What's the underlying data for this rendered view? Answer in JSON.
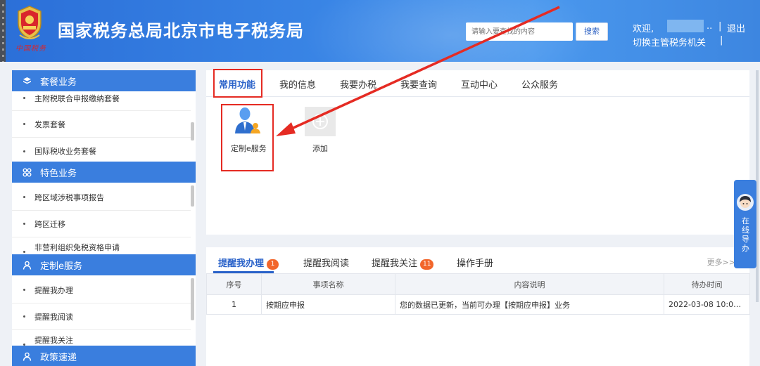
{
  "header": {
    "site_title": "国家税务总局北京市电子税务局",
    "emblem_text": "中国税务",
    "search_placeholder": "请输入要查找的内容",
    "search_button": "搜索",
    "welcome": "欢迎,",
    "dots": "..",
    "separator": "|",
    "logout": "退出",
    "switch_org": "切换主管税务机关"
  },
  "sidebar": {
    "sections": [
      {
        "label": "套餐业务",
        "icon": "package-icon"
      },
      {
        "label": "特色业务",
        "icon": "grid-icon"
      },
      {
        "label": "定制e服务",
        "icon": "user-icon"
      },
      {
        "label": "政策速递",
        "icon": "user-icon"
      }
    ],
    "items": [
      "主附税联合申报缴纳套餐",
      "发票套餐",
      "国际税收业务套餐",
      "跨区域涉税事项报告",
      "跨区迁移",
      "非营利组织免税资格申请",
      "提醒我办理",
      "提醒我阅读",
      "提醒我关注"
    ]
  },
  "function_panel": {
    "tabs": [
      "常用功能",
      "我的信息",
      "我要办税",
      "我要查询",
      "互动中心",
      "公众服务"
    ],
    "active_tab": 0,
    "tiles": [
      {
        "label": "定制e服务",
        "icon": "user-service-icon"
      },
      {
        "label": "添加",
        "icon": "add-icon"
      }
    ]
  },
  "reminders": {
    "tabs": [
      {
        "label": "提醒我办理",
        "badge": "1"
      },
      {
        "label": "提醒我阅读",
        "badge": ""
      },
      {
        "label": "提醒我关注",
        "badge": "11"
      },
      {
        "label": "操作手册",
        "badge": ""
      }
    ],
    "more": "更多>>",
    "columns": [
      "序号",
      "事项名称",
      "内容说明",
      "待办时间"
    ],
    "rows": [
      [
        "1",
        "按期应申报",
        "您的数据已更新，当前可办理【按期应申报】业务",
        "2022-03-08 10:09:..."
      ]
    ]
  },
  "online_guide": {
    "label": "在线导办"
  },
  "colors": {
    "primary": "#3a7ede",
    "highlight": "#e52b23",
    "badge": "#f2662b"
  }
}
